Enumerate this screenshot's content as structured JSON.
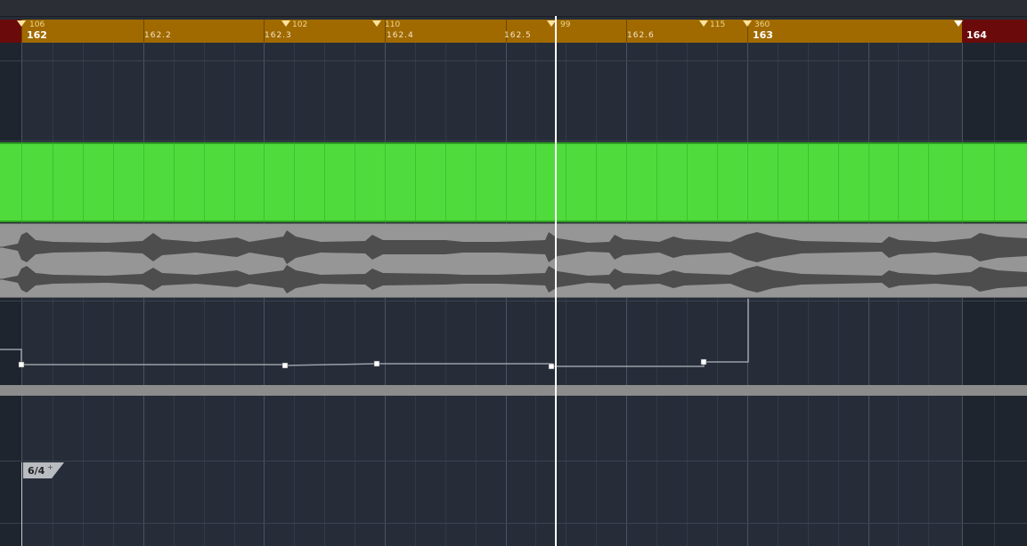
{
  "ruler": {
    "major_162": "162",
    "major_163": "163",
    "major_164": "164",
    "sub_1": "162.2",
    "sub_2": "162.3",
    "sub_3": "162.4",
    "sub_4": "162.5",
    "sub_5": "162.6",
    "tempo_1": "106",
    "tempo_2": "102",
    "tempo_3": "110",
    "tempo_4": "99",
    "tempo_5": "115",
    "tempo_6": "360"
  },
  "signature": {
    "label": "6/4"
  },
  "colors": {
    "ruler": "#a06a00",
    "ruler_out_of_range": "#6a0a0a",
    "midi_part": "#4fdb3c",
    "audio_part": "#969696",
    "background": "#262d38",
    "cursor": "#ffffff"
  }
}
